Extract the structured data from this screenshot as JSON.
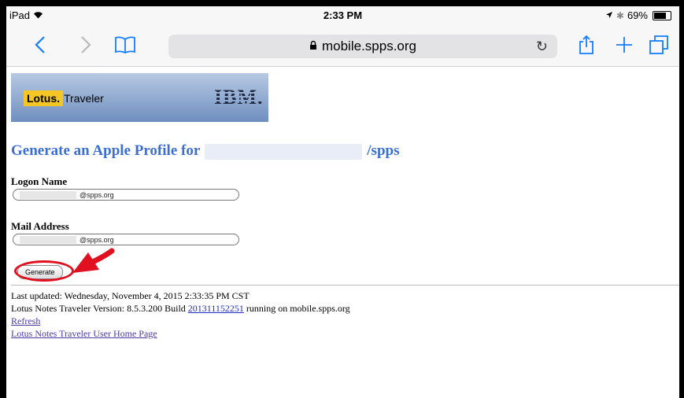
{
  "status_bar": {
    "device": "iPad",
    "time": "2:33 PM",
    "battery": "69%",
    "battery_level": 0.69
  },
  "toolbar": {
    "back_icon": "chevron-left-icon",
    "forward_icon": "chevron-right-icon",
    "bookmarks_icon": "book-icon",
    "url": "mobile.spps.org",
    "reload_icon": "reload-icon",
    "share_icon": "share-icon",
    "new_tab_icon": "plus-icon",
    "tabs_icon": "tabs-icon"
  },
  "page": {
    "banner": {
      "lotus": "Lotus.",
      "traveler": "Traveler",
      "ibm": "IBM."
    },
    "heading_prefix": "Generate an Apple Profile for",
    "heading_suffix": "/spps",
    "logon_label": "Logon Name",
    "logon_value": "@spps.org",
    "mail_label": "Mail Address",
    "mail_value": "@spps.org",
    "generate_label": "Generate",
    "last_updated": "Last updated: Wednesday, November 4, 2015 2:33:35 PM CST",
    "version_prefix": "Lotus Notes Traveler Version: 8.5.3.200 Build",
    "build_link": "201311152251",
    "version_suffix": "running on mobile.spps.org",
    "refresh_link": "Refresh",
    "home_link": "Lotus Notes Traveler User Home Page"
  },
  "colors": {
    "accent": "#147efb",
    "heading": "#3b6fd4",
    "annotation": "#e01020"
  }
}
